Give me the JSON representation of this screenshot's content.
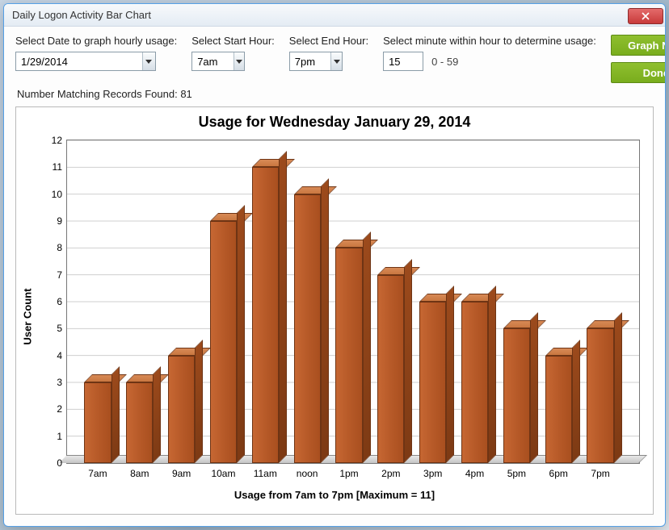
{
  "window": {
    "title": "Daily Logon Activity Bar Chart"
  },
  "controls": {
    "date": {
      "label": "Select Date to graph hourly usage:",
      "value": "1/29/2014"
    },
    "start": {
      "label": "Select Start Hour:",
      "value": "7am"
    },
    "end": {
      "label": "Select End Hour:",
      "value": "7pm"
    },
    "minute": {
      "label": "Select minute within hour to determine usage:",
      "value": "15",
      "range": "0 - 59"
    },
    "graph_btn": "Graph Now",
    "done_btn": "Done"
  },
  "match": {
    "prefix": "Number Matching Records Found: ",
    "count": "81"
  },
  "chart_data": {
    "type": "bar",
    "title": "Usage for Wednesday January 29, 2014",
    "xlabel": "Usage from 7am to 7pm [Maximum = 11]",
    "ylabel": "User Count",
    "categories": [
      "7am",
      "8am",
      "9am",
      "10am",
      "11am",
      "noon",
      "1pm",
      "2pm",
      "3pm",
      "4pm",
      "5pm",
      "6pm",
      "7pm"
    ],
    "values": [
      3,
      3,
      4,
      9,
      11,
      10,
      8,
      7,
      6,
      6,
      5,
      4,
      5
    ],
    "ylim": [
      0,
      12
    ],
    "yticks": [
      0,
      1,
      2,
      3,
      4,
      5,
      6,
      7,
      8,
      9,
      10,
      11,
      12
    ]
  }
}
